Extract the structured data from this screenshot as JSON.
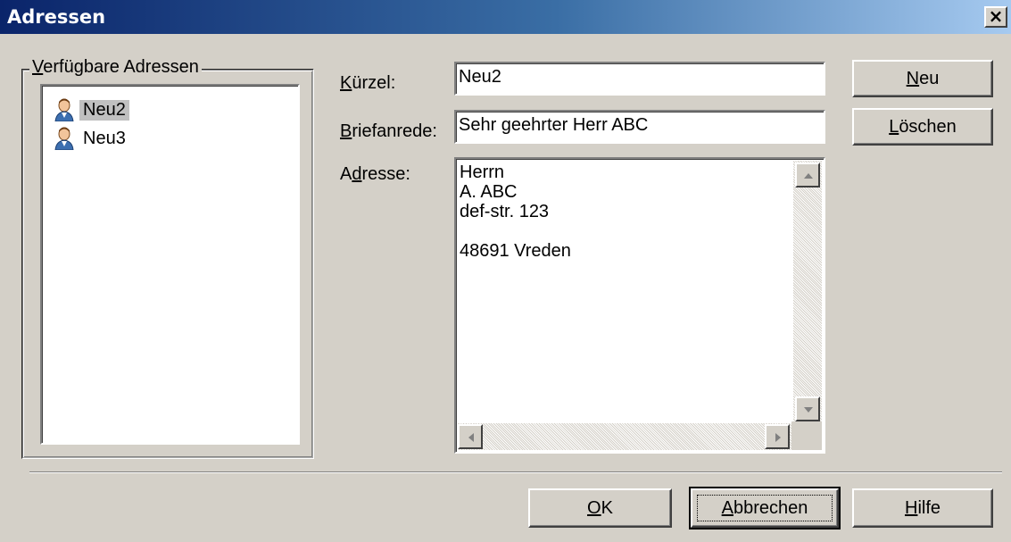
{
  "window": {
    "title": "Adressen",
    "close_label": "×"
  },
  "group": {
    "legend_first": "V",
    "legend_rest": "erfügbare Adressen"
  },
  "list": {
    "items": [
      {
        "label": "Neu2"
      },
      {
        "label": "Neu3"
      }
    ]
  },
  "fields": {
    "kuerzel": {
      "label_ul": "K",
      "label_rest": "ürzel:",
      "value": "Neu2"
    },
    "briefanrede": {
      "label_ul": "B",
      "label_rest": "riefanrede:",
      "value": "Sehr geehrter Herr ABC"
    },
    "adresse": {
      "label_pre": "A",
      "label_ul": "d",
      "label_rest": "resse:",
      "value": "Herrn\nA. ABC\ndef-str. 123\n\n48691 Vreden"
    }
  },
  "buttons": {
    "neu": {
      "ul": "N",
      "rest": "eu"
    },
    "loeschen": {
      "ul": "L",
      "rest": "öschen"
    },
    "ok": {
      "ul": "O",
      "rest": "K"
    },
    "abbrechen": {
      "ul": "A",
      "rest": "bbrechen"
    },
    "hilfe": {
      "ul": "H",
      "rest": "ilfe"
    }
  },
  "colors": {
    "title_start": "#0a246a",
    "title_end": "#a6caf0",
    "dialog_bg": "#d4d0c8"
  }
}
